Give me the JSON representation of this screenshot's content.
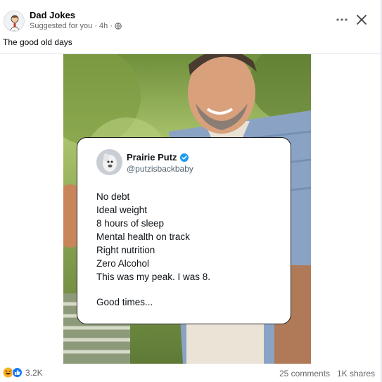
{
  "post": {
    "page_name": "Dad Jokes",
    "meta_text": "Suggested for you · 4h ·",
    "caption": "The good old days",
    "icons": {
      "more": "more-dots-icon",
      "close": "close-icon",
      "privacy": "globe-icon"
    }
  },
  "tweet": {
    "name": "Prairie Putz",
    "handle": "@putzisbackbaby",
    "lines": [
      "No debt",
      "Ideal weight",
      "8 hours of sleep",
      "Mental health on track",
      "Right nutrition",
      "Zero Alcohol",
      "This was my peak. I was 8."
    ],
    "closing": "Good times..."
  },
  "footer": {
    "reaction_count": "3.2K",
    "comments": "25 comments",
    "shares": "1K shares",
    "reaction_icons": [
      "haha-icon",
      "like-icon"
    ]
  },
  "colors": {
    "link_blue": "#1877f2",
    "verified_blue": "#1d9bf0",
    "secondary_text": "#65676b"
  }
}
